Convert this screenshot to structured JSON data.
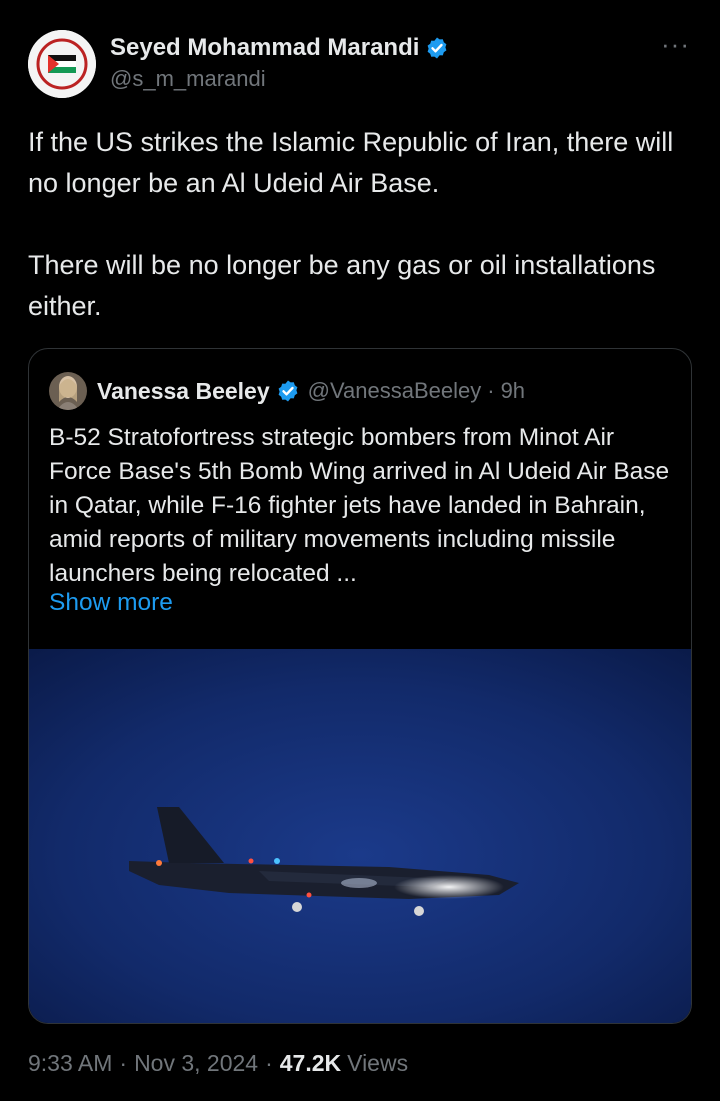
{
  "author": {
    "display_name": "Seyed Mohammad Marandi",
    "handle": "@s_m_marandi",
    "verified_badge_icon": "verified-badge-icon",
    "avatar_icon": "palestine-flag-avatar"
  },
  "more_label": "···",
  "tweet": {
    "text": "If the US strikes the Islamic Republic of Iran, there will no longer be an Al Udeid Air Base.\n\nThere will be no longer be any gas or oil installations either."
  },
  "quote": {
    "display_name": "Vanessa Beeley",
    "handle": "@VanessaBeeley",
    "separator": "·",
    "time": "9h",
    "text": "B-52 Stratofortress strategic bombers from Minot Air Force Base's 5th Bomb Wing arrived in Al Udeid Air Base in Qatar, while F-16 fighter jets have landed in Bahrain, amid reports of military movements including missile launchers being relocated ...",
    "show_more": "Show more",
    "media_description_icon": "b52-night-photo"
  },
  "meta": {
    "time": "9:33 AM",
    "date": "Nov 3, 2024",
    "separator": "·",
    "views_count": "47.2K",
    "views_label": "Views"
  },
  "colors": {
    "background": "#000000",
    "text_primary": "#e7e9ea",
    "text_secondary": "#71767b",
    "link": "#1d9bf0",
    "border": "#2f3336",
    "verified": "#1d9bf0"
  }
}
